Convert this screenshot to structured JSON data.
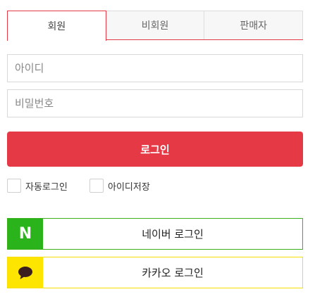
{
  "tabs": [
    {
      "label": "회원",
      "active": true
    },
    {
      "label": "비회원",
      "active": false
    },
    {
      "label": "판매자",
      "active": false
    }
  ],
  "form": {
    "id_placeholder": "아이디",
    "password_placeholder": "비밀번호",
    "login_label": "로그인",
    "auto_login_label": "자동로그인",
    "save_id_label": "아이디저장"
  },
  "sns": {
    "naver_label": "네이버 로그인",
    "naver_logo_text": "N",
    "naver_icon": "naver-n-icon",
    "kakao_label": "카카오 로그인",
    "kakao_icon": "kakao-speech-bubble-icon"
  },
  "colors": {
    "accent": "#e63946",
    "naver_green": "#2ab31a",
    "kakao_yellow": "#fee500"
  }
}
